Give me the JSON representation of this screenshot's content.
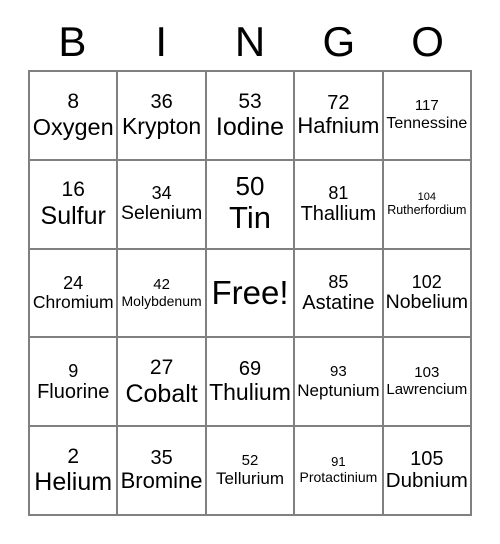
{
  "header": {
    "letters": [
      "B",
      "I",
      "N",
      "G",
      "O"
    ]
  },
  "free_space": {
    "label": "Free!"
  },
  "grid": {
    "rows": [
      [
        {
          "number": "8",
          "name": "Oxygen"
        },
        {
          "number": "36",
          "name": "Krypton"
        },
        {
          "number": "53",
          "name": "Iodine"
        },
        {
          "number": "72",
          "name": "Hafnium"
        },
        {
          "number": "117",
          "name": "Tennessine"
        }
      ],
      [
        {
          "number": "16",
          "name": "Sulfur"
        },
        {
          "number": "34",
          "name": "Selenium"
        },
        {
          "number": "50",
          "name": "Tin"
        },
        {
          "number": "81",
          "name": "Thallium"
        },
        {
          "number": "104",
          "name": "Rutherfordium"
        }
      ],
      [
        {
          "number": "24",
          "name": "Chromium"
        },
        {
          "number": "42",
          "name": "Molybdenum"
        },
        {
          "number": "",
          "name": "Free!"
        },
        {
          "number": "85",
          "name": "Astatine"
        },
        {
          "number": "102",
          "name": "Nobelium"
        }
      ],
      [
        {
          "number": "9",
          "name": "Fluorine"
        },
        {
          "number": "27",
          "name": "Cobalt"
        },
        {
          "number": "69",
          "name": "Thulium"
        },
        {
          "number": "93",
          "name": "Neptunium"
        },
        {
          "number": "103",
          "name": "Lawrencium"
        }
      ],
      [
        {
          "number": "2",
          "name": "Helium"
        },
        {
          "number": "35",
          "name": "Bromine"
        },
        {
          "number": "52",
          "name": "Tellurium"
        },
        {
          "number": "91",
          "name": "Protactinium"
        },
        {
          "number": "105",
          "name": "Dubnium"
        }
      ]
    ]
  },
  "colors": {
    "border": "#808080",
    "text": "#000000",
    "background": "#ffffff"
  }
}
